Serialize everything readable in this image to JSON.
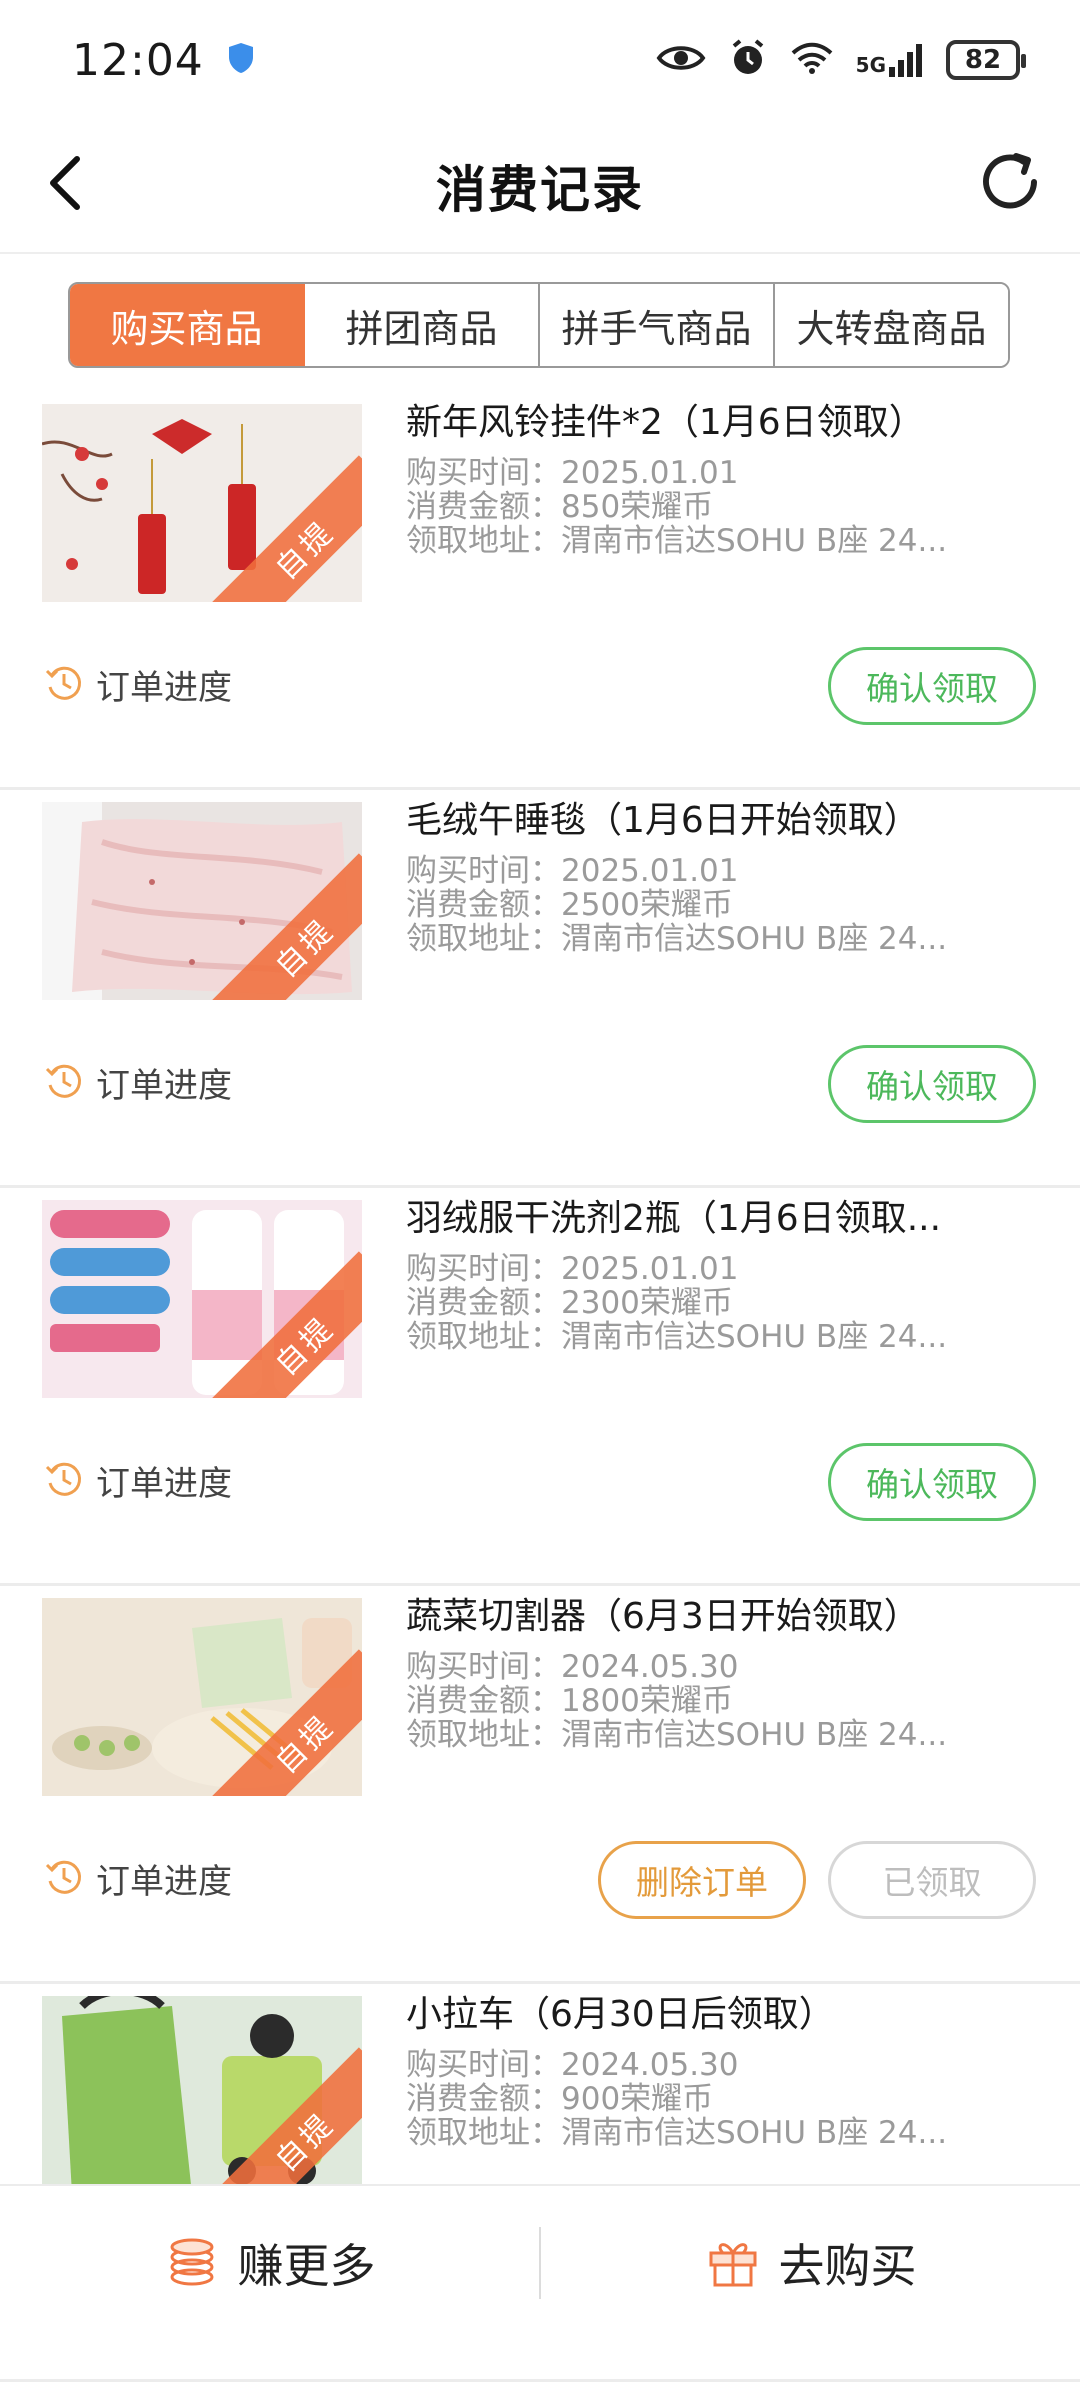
{
  "status": {
    "time": "12:04",
    "network": "5G",
    "battery": "82"
  },
  "header": {
    "title": "消费记录"
  },
  "tabs": [
    {
      "label": "购买商品",
      "active": true
    },
    {
      "label": "拼团商品",
      "active": false
    },
    {
      "label": "拼手气商品",
      "active": false
    },
    {
      "label": "大转盘商品",
      "active": false
    }
  ],
  "labels": {
    "purchase_time": "购买时间：",
    "amount": "消费金额：",
    "address": "领取地址：",
    "progress": "订单进度",
    "pickup_badge": "自提",
    "confirm": "确认领取",
    "delete": "删除订单",
    "claimed": "已领取"
  },
  "orders": [
    {
      "title": "新年风铃挂件*2（1月6日领取）",
      "time": "2025.01.01",
      "amount": "850荣耀币",
      "address": "渭南市信达SOHU B座 24...",
      "status": "pending",
      "image_icon": "wind-chime-product-image"
    },
    {
      "title": "毛绒午睡毯（1月6日开始领取）",
      "time": "2025.01.01",
      "amount": "2500荣耀币",
      "address": "渭南市信达SOHU B座 24...",
      "status": "pending",
      "image_icon": "blanket-product-image"
    },
    {
      "title": "羽绒服干洗剂2瓶（1月6日领取...",
      "time": "2025.01.01",
      "amount": "2300荣耀币",
      "address": "渭南市信达SOHU B座 24...",
      "status": "pending",
      "image_icon": "dry-cleaner-product-image"
    },
    {
      "title": "蔬菜切割器（6月3日开始领取）",
      "time": "2024.05.30",
      "amount": "1800荣耀币",
      "address": "渭南市信达SOHU B座 24...",
      "status": "claimed",
      "image_icon": "vegetable-cutter-product-image"
    },
    {
      "title": "小拉车（6月30日后领取）",
      "time": "2024.05.30",
      "amount": "900荣耀币",
      "address": "渭南市信达SOHU B座 24...",
      "status": "pending",
      "image_icon": "trolley-product-image"
    }
  ],
  "bottom": {
    "earn_label": "赚更多",
    "buy_label": "去购买"
  },
  "colors": {
    "accent": "#f07743",
    "confirm": "#5cc56a",
    "delete": "#e8a24a",
    "claimed": "#d7d7d7"
  }
}
